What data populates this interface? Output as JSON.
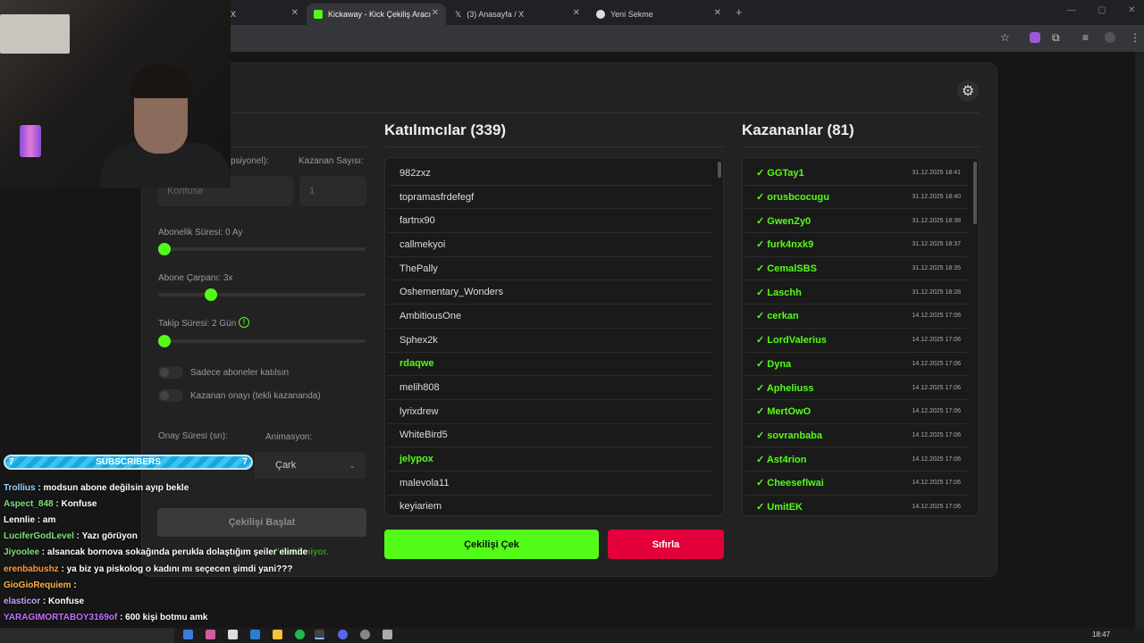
{
  "browser": {
    "tabs": [
      {
        "label": "X"
      },
      {
        "label": "Kickaway - Kick Çekiliş Aracı"
      },
      {
        "label": "(3) Anasayfa / X"
      },
      {
        "label": "Yeni Sekme"
      }
    ]
  },
  "settings": {
    "winner_count_label": "Kazanan Sayısı:",
    "keyword_label_partial": "psiyonel):",
    "keyword_placeholder": "Konfuse",
    "winner_count_value": "1",
    "sub_duration_label": "Abonelik Süresi: 0 Ay",
    "sub_multiplier_label": "Abone Çarpanı: 3x",
    "follow_duration_label": "Takip Süresi: 2 Gün",
    "only_subs_label": "Sadece aboneler katılsın",
    "winner_confirm_label": "Kazanan onayı (tekli kazananda)",
    "confirm_duration_label": "Onay Süresi (sn):",
    "animation_label": "Animasyon:",
    "animation_value": "Çark",
    "start_button": "Çekilişi Başlat",
    "waiting_text_partial": "\" bekleniyor.",
    "sliders": {
      "sub_duration": 0,
      "sub_multiplier": 0.24,
      "follow_duration": 0
    }
  },
  "participants": {
    "title": "Katılımcılar (339)",
    "items": [
      {
        "name": "982zxz",
        "highlight": false
      },
      {
        "name": "topramasfrdefegf",
        "highlight": false
      },
      {
        "name": "fartnx90",
        "highlight": false
      },
      {
        "name": "callmekyoi",
        "highlight": false
      },
      {
        "name": "ThePally",
        "highlight": false
      },
      {
        "name": "Oshementary_Wonders",
        "highlight": false
      },
      {
        "name": "AmbitiousOne",
        "highlight": false
      },
      {
        "name": "Sphex2k",
        "highlight": false
      },
      {
        "name": "rdaqwe",
        "highlight": true
      },
      {
        "name": "melih808",
        "highlight": false
      },
      {
        "name": "lyrixdrew",
        "highlight": false
      },
      {
        "name": "WhiteBird5",
        "highlight": false
      },
      {
        "name": "jelypox",
        "highlight": true
      },
      {
        "name": "malevola11",
        "highlight": false
      },
      {
        "name": "keyiariem",
        "highlight": false
      }
    ],
    "draw_button": "Çekilişi Çek",
    "reset_button": "Sıfırla"
  },
  "winners": {
    "title": "Kazananlar (81)",
    "items": [
      {
        "name": "✓ GGTay1",
        "date": "31.12.2025 18:41"
      },
      {
        "name": "✓ orusbcocugu",
        "date": "31.12.2025 18:40"
      },
      {
        "name": "✓ GwenZy0",
        "date": "31.12.2025 18:38"
      },
      {
        "name": "✓ furk4nxk9",
        "date": "31.12.2025 18:37"
      },
      {
        "name": "✓ CemalSBS",
        "date": "31.12.2025 18:35"
      },
      {
        "name": "✓ Laschh",
        "date": "31.12.2025 18:28"
      },
      {
        "name": "✓ cerkan",
        "date": "14.12.2025 17:06"
      },
      {
        "name": "✓ LordValerius",
        "date": "14.12.2025 17:06"
      },
      {
        "name": "✓ Dyna",
        "date": "14.12.2025 17:06"
      },
      {
        "name": "✓ Apheliuss",
        "date": "14.12.2025 17:06"
      },
      {
        "name": "✓ MertOwO",
        "date": "14.12.2025 17:06"
      },
      {
        "name": "✓ sovranbaba",
        "date": "14.12.2025 17:06"
      },
      {
        "name": "✓ Ast4rion",
        "date": "14.12.2025 17:06"
      },
      {
        "name": "✓ Cheeseflwai",
        "date": "14.12.2025 17:06"
      },
      {
        "name": "✓ UmitEK",
        "date": "14.12.2025 17:06"
      }
    ]
  },
  "overlay": {
    "subs_left": "7",
    "subs_label": "SUBSCRIBERS",
    "subs_right": "7",
    "chat": [
      {
        "user": "Trollius",
        "color": "#9ad4ff",
        "msg": " : modsun abone değilsin ayıp bekle"
      },
      {
        "user": "Aspect_848",
        "color": "#7ee07e",
        "msg": " : Konfuse"
      },
      {
        "user": "Lennlie",
        "color": "#ffffff",
        "msg": " : am"
      },
      {
        "user": "LuciferGodLevel",
        "color": "#7ee07e",
        "msg": " : Yazı görüyon"
      },
      {
        "user": "Jiyoolee",
        "color": "#7ee07e",
        "msg": " : alsancak bornova sokağında perukla dolaştığım şeiler elimde"
      },
      {
        "user": "erenbabushz",
        "color": "#ff9a3c",
        "msg": " : ya biz ya piskolog o kadını mı seçecen şimdi yani???"
      },
      {
        "user": "GioGioRequiem",
        "color": "#ffb347",
        "msg": " :"
      },
      {
        "user": "elasticor",
        "color": "#c9a0ff",
        "msg": " : Konfuse"
      },
      {
        "user": "YARAGIMORTABOY3169of",
        "color": "#c070ff",
        "msg": " : 600 kişi botmu amk"
      }
    ]
  },
  "taskbar": {
    "time": "18:47"
  },
  "colors": {
    "accent": "#53fc18",
    "danger": "#e4003a",
    "card": "#222222"
  }
}
